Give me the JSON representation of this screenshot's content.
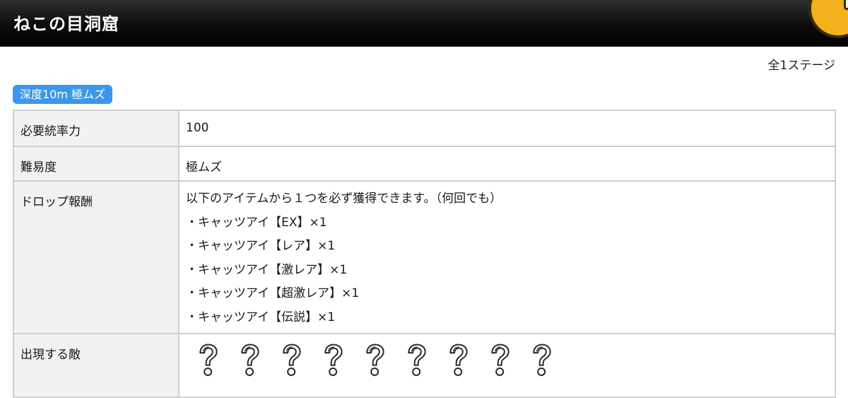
{
  "header": {
    "title": "ねこの目洞窟",
    "corner_icon": "back-arrow-icon",
    "corner_color": "#f2b21b"
  },
  "stage_count": "全1ステージ",
  "stage_tag": {
    "label": "深度10m 極ムズ",
    "color": "#3c97e8"
  },
  "table": {
    "rows": {
      "control": {
        "label": "必要統率力",
        "value": "100"
      },
      "difficulty": {
        "label": "難易度",
        "value": "極ムズ"
      },
      "drops": {
        "label": "ドロップ報酬",
        "intro": "以下のアイテムから１つを必ず獲得できます。（何回でも）",
        "items": [
          "・キャッツアイ【EX】×1",
          "・キャッツアイ【レア】×1",
          "・キャッツアイ【激レア】×1",
          "・キャッツアイ【超激レア】×1",
          "・キャッツアイ【伝説】×1"
        ]
      },
      "enemies": {
        "label": "出現する敵",
        "icons": [
          "unknown-enemy-icon",
          "unknown-enemy-icon",
          "unknown-enemy-icon",
          "unknown-enemy-icon",
          "unknown-enemy-icon",
          "unknown-enemy-icon",
          "unknown-enemy-icon",
          "unknown-enemy-icon",
          "unknown-enemy-icon"
        ]
      }
    }
  }
}
